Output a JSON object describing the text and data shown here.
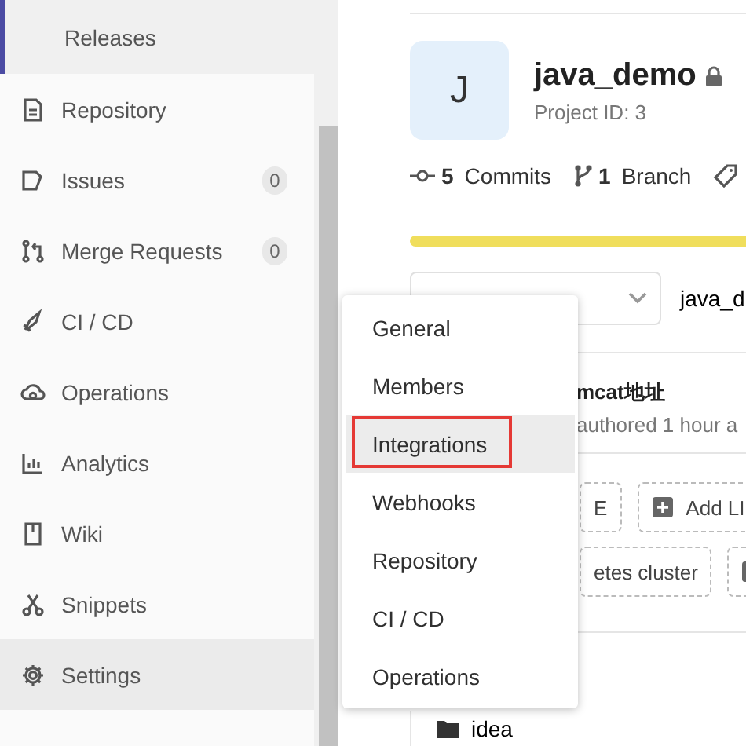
{
  "sidebar": {
    "subitem": {
      "label": "Releases",
      "selected": true
    },
    "items": [
      {
        "label": "Repository",
        "selected": false
      },
      {
        "label": "Issues",
        "badge": "0",
        "selected": false
      },
      {
        "label": "Merge Requests",
        "badge": "0",
        "selected": false
      },
      {
        "label": "CI / CD",
        "selected": false
      },
      {
        "label": "Operations",
        "selected": false
      },
      {
        "label": "Analytics",
        "selected": false
      },
      {
        "label": "Wiki",
        "selected": false
      },
      {
        "label": "Snippets",
        "selected": false
      },
      {
        "label": "Settings",
        "selected": true
      }
    ]
  },
  "settings_menu": {
    "items": [
      {
        "label": "General",
        "selected": false,
        "outlined": false
      },
      {
        "label": "Members",
        "selected": false,
        "outlined": false
      },
      {
        "label": "Integrations",
        "selected": true,
        "outlined": true
      },
      {
        "label": "Webhooks",
        "selected": false,
        "outlined": false
      },
      {
        "label": "Repository",
        "selected": false,
        "outlined": false
      },
      {
        "label": "CI / CD",
        "selected": false,
        "outlined": false
      },
      {
        "label": "Operations",
        "selected": false,
        "outlined": false
      }
    ]
  },
  "project": {
    "avatar": "J",
    "name": "java_demo",
    "id_label": "Project ID: 3",
    "stats": [
      {
        "count": "5",
        "label": "Commits"
      },
      {
        "count": "1",
        "label": "Branch"
      }
    ],
    "path": "java_d",
    "commit": {
      "title": "mcat地址",
      "meta": "authored 1 hour a"
    },
    "buttons": [
      [
        {
          "kind": "text",
          "label": "E"
        },
        {
          "kind": "add",
          "label": "Add LI"
        }
      ],
      [
        {
          "kind": "text",
          "label": "etes cluster"
        },
        {
          "kind": "add"
        }
      ]
    ],
    "files": [
      "idea"
    ]
  }
}
